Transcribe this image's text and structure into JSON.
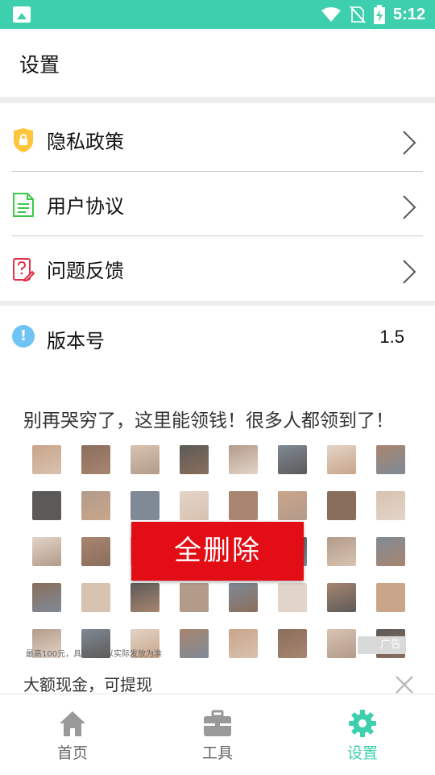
{
  "status_bar": {
    "time": "5:12"
  },
  "header": {
    "title": "设置"
  },
  "menu": {
    "items": [
      {
        "label": "隐私政策",
        "icon": "shield-lock-icon"
      },
      {
        "label": "用户协议",
        "icon": "document-icon"
      },
      {
        "label": "问题反馈",
        "icon": "feedback-icon"
      }
    ]
  },
  "version": {
    "label": "版本号",
    "value": "1.5",
    "icon": "info-icon"
  },
  "ad": {
    "headline": "别再哭穷了，这里能领钱！很多人都领到了！",
    "button": "全删除",
    "disclaimer": "最高100元，具体金额以实际发放为准",
    "badge": "广告",
    "subline": "大额现金，可提现"
  },
  "tabbar": {
    "tabs": [
      {
        "label": "首页",
        "icon": "home-icon"
      },
      {
        "label": "工具",
        "icon": "toolbox-icon"
      },
      {
        "label": "设置",
        "icon": "gear-icon"
      }
    ],
    "active_index": 2
  },
  "colors": {
    "accent": "#3ecfae",
    "delete_button": "#e30d15",
    "divider": "#c8c8c8",
    "section_gap": "#ededed"
  }
}
